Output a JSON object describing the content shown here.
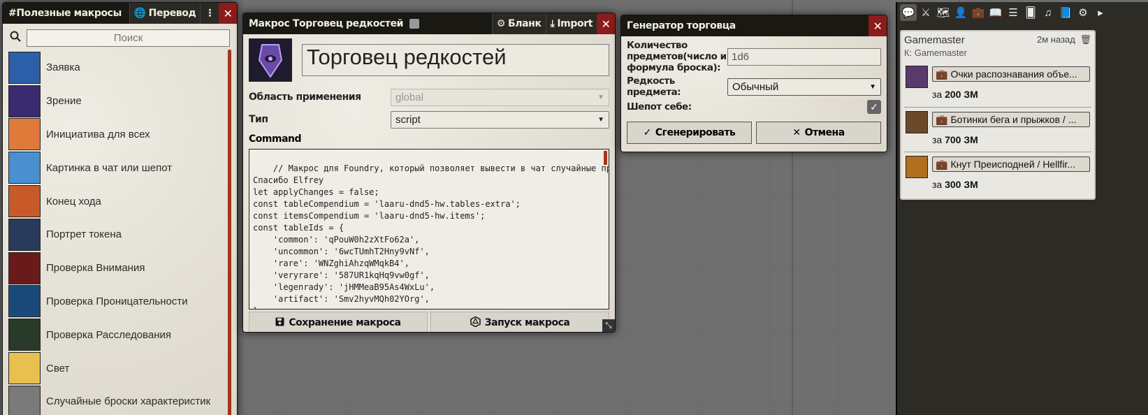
{
  "macro_list": {
    "title": "#Полезные макросы",
    "translate_label": "Перевод",
    "menu_icon": "vertical-ellipsis-icon",
    "close_icon": "close-icon",
    "search_placeholder": "Поиск",
    "items": [
      {
        "label": "Заявка",
        "icon": "raised-hand-icon",
        "color": "#2c5fa8"
      },
      {
        "label": "Зрение",
        "icon": "eye-icon",
        "color": "#3a2a6e"
      },
      {
        "label": "Инициатива для всех",
        "icon": "d20-icon",
        "color": "#e07a3a"
      },
      {
        "label": "Картинка в чат или шепот",
        "icon": "envelope-icon",
        "color": "#4a8fd0"
      },
      {
        "label": "Конец хода",
        "icon": "crossed-swords-icon",
        "color": "#c85a2a"
      },
      {
        "label": "Портрет токена",
        "icon": "portrait-icon",
        "color": "#2a3a5a"
      },
      {
        "label": "Проверка Внимания",
        "icon": "red-eye-icon",
        "color": "#6a1a1a"
      },
      {
        "label": "Проверка Проницательности",
        "icon": "brain-head-icon",
        "color": "#1a4a7a"
      },
      {
        "label": "Проверка Расследования",
        "icon": "question-marks-icon",
        "color": "#2a3a2a"
      },
      {
        "label": "Свет",
        "icon": "lantern-icon",
        "color": "#e8c050"
      },
      {
        "label": "Случайные броски характеристик",
        "icon": "dice-icon",
        "color": "#7a7a7a"
      }
    ]
  },
  "macro_config": {
    "title": "Макрос Торговец редкостей",
    "blank_label": "Бланк",
    "import_label": "Import",
    "name": "Торговец редкостей",
    "scope_label": "Область применения",
    "scope_value": "global",
    "type_label": "Тип",
    "type_value": "script",
    "command_label": "Command",
    "command_text": "// Макрос для Foundry, который позволяет вывести в чат случайные предметы.\nСпасибо Elfrey\nlet applyChanges = false;\nconst tableCompendium = 'laaru-dnd5-hw.tables-extra';\nconst itemsCompendium = 'laaru-dnd5-hw.items';\nconst tableIds = {\n    'common': 'qPouW0h2zXtFo62a',\n    'uncommon': '6wcTUmhT2Hny9vNf',\n    'rare': 'WNZghiAhzqWMqkB4',\n    'veryrare': '587UR1kqHq9vw0gf',\n    'legenrady': 'jHMMeaB95As4WxLu',\n    'artifact': 'Smv2hyvMQh02YOrg',\n}",
    "save_label": "Сохранение макроса",
    "execute_label": "Запуск макроса"
  },
  "trader_dialog": {
    "title": "Генератор торговца",
    "count_label": "Количество предметов(число и формула броска):",
    "count_value": "1d6",
    "rarity_label": "Редкость предмета:",
    "rarity_value": "Обычный",
    "whisper_label": "Шепот себе:",
    "whisper_checked": true,
    "generate_label": "Сгенерировать",
    "cancel_label": "Отмена"
  },
  "sidebar": {
    "tabs": [
      "chat-icon",
      "combat-icon",
      "map-icon",
      "actors-icon",
      "items-icon",
      "journal-icon",
      "tables-icon",
      "cards-icon",
      "playlists-icon",
      "compendium-icon",
      "settings-icon",
      "collapse-icon"
    ],
    "message": {
      "speaker": "Gamemaster",
      "time": "2м назад",
      "whisper_to": "К: Gamemaster",
      "price_prefix": "за",
      "entries": [
        {
          "name": "Очки распознавания объе...",
          "price": "200 ЗМ",
          "color": "#5a3a6a"
        },
        {
          "name": "Ботинки бега и прыжков / ...",
          "price": "700 ЗМ",
          "color": "#6a4a2a"
        },
        {
          "name": "Кнут Преисподней / Hellfir...",
          "price": "300 ЗМ",
          "color": "#b07020"
        }
      ]
    }
  }
}
